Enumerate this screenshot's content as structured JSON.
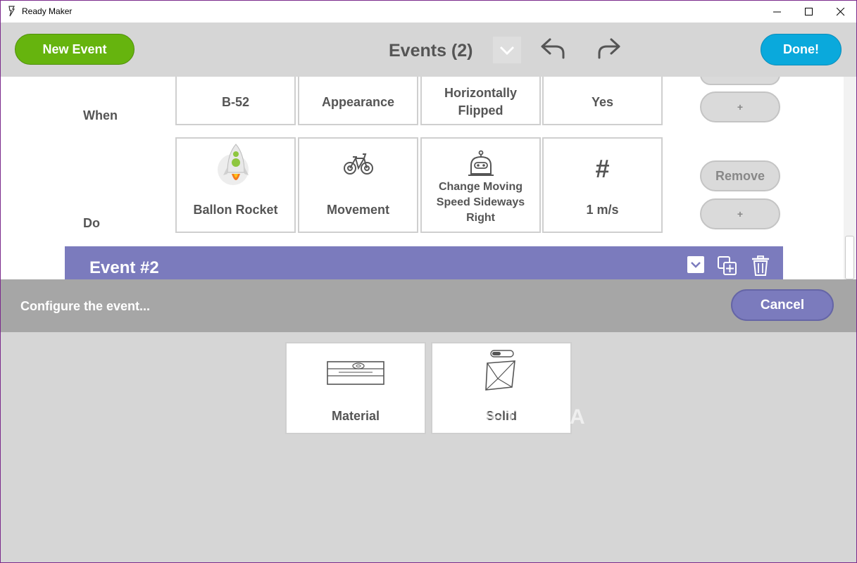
{
  "window": {
    "title": "Ready Maker"
  },
  "header": {
    "new_event_label": "New Event",
    "events_title": "Events (2)",
    "done_label": "Done!"
  },
  "event1": {
    "when_label": "When",
    "do_label": "Do",
    "when_cells": [
      "B-52",
      "Appearance",
      "Horizontally Flipped",
      "Yes"
    ],
    "do_cells": [
      "Ballon Rocket",
      "Movement",
      "Change Moving Speed Sideways Right",
      "1 m/s"
    ],
    "do_value_icon_text": "#",
    "add_label": "+",
    "remove_label": "Remove"
  },
  "event2": {
    "title": "Event #2"
  },
  "config": {
    "prompt": "Configure the event...",
    "cancel_label": "Cancel"
  },
  "options": [
    {
      "label": "Material",
      "icon": "material-icon"
    },
    {
      "label": "Solid",
      "icon": "solid-icon"
    }
  ],
  "watermark": "SOFTPEDIA",
  "colors": {
    "green": "#66b40e",
    "blue": "#0aa9dc",
    "purple": "#7b7bbd",
    "gray_bar": "#a6a6a6"
  }
}
